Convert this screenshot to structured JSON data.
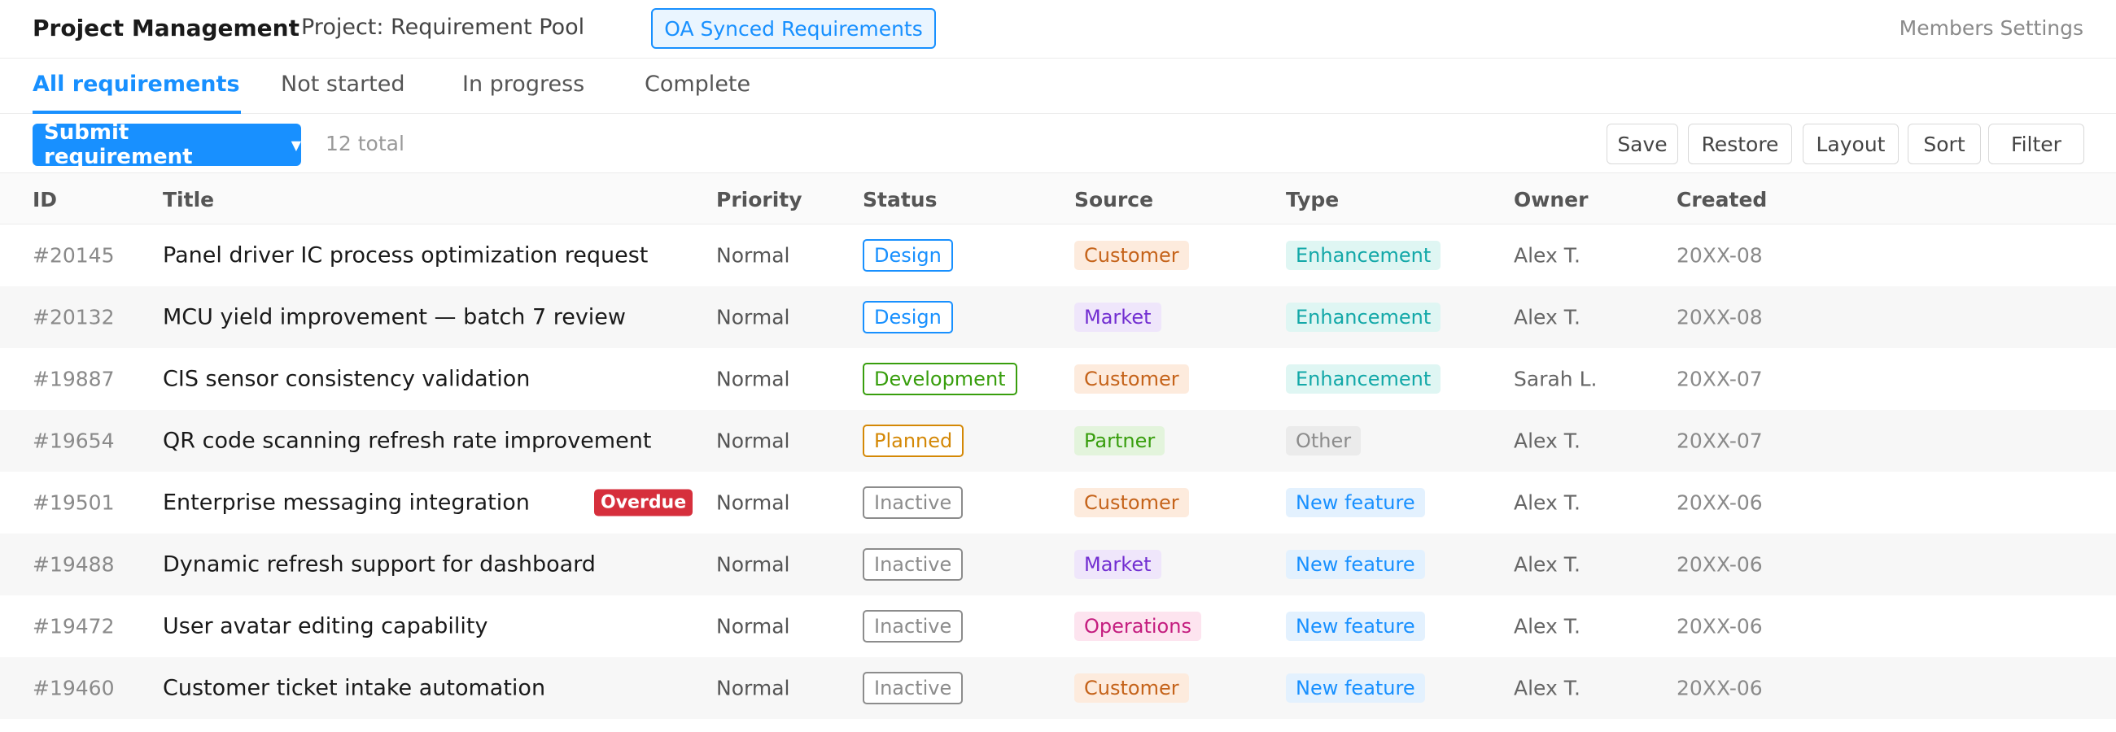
{
  "header": {
    "app_title": "Project Management",
    "project_name": "Project: Requirement Pool",
    "oa_button": "OA Synced Requirements",
    "members_settings": "Members Settings"
  },
  "tabs": [
    {
      "label": "All requirements",
      "active": true
    },
    {
      "label": "Not started",
      "active": false
    },
    {
      "label": "In progress",
      "active": false
    },
    {
      "label": "Complete",
      "active": false
    }
  ],
  "toolbar": {
    "submit_label": "Submit requirement",
    "total": "12 total",
    "buttons": [
      "Save",
      "Restore",
      "Layout",
      "Sort",
      "Filter"
    ]
  },
  "table": {
    "columns": [
      "ID",
      "Title",
      "Priority",
      "Status",
      "Source",
      "Type",
      "Owner",
      "Created"
    ],
    "rows": [
      {
        "id": "#20145",
        "title": "Panel driver IC process optimization request",
        "overdue": "",
        "priority": "Normal",
        "status": "Design",
        "source": "Customer",
        "type": "Enhancement",
        "owner": "Alex T.",
        "created": "20XX-08"
      },
      {
        "id": "#20132",
        "title": "MCU yield improvement — batch 7 review",
        "overdue": "",
        "priority": "Normal",
        "status": "Design",
        "source": "Market",
        "type": "Enhancement",
        "owner": "Alex T.",
        "created": "20XX-08"
      },
      {
        "id": "#19887",
        "title": "CIS sensor consistency validation",
        "overdue": "",
        "priority": "Normal",
        "status": "Development",
        "source": "Customer",
        "type": "Enhancement",
        "owner": "Sarah L.",
        "created": "20XX-07"
      },
      {
        "id": "#19654",
        "title": "QR code scanning refresh rate improvement",
        "overdue": "",
        "priority": "Normal",
        "status": "Planned",
        "source": "Partner",
        "type": "Other",
        "owner": "Alex T.",
        "created": "20XX-07"
      },
      {
        "id": "#19501",
        "title": "Enterprise messaging integration",
        "overdue": "Overdue",
        "priority": "Normal",
        "status": "Inactive",
        "source": "Customer",
        "type": "New feature",
        "owner": "Alex T.",
        "created": "20XX-06"
      },
      {
        "id": "#19488",
        "title": "Dynamic refresh support for dashboard",
        "overdue": "",
        "priority": "Normal",
        "status": "Inactive",
        "source": "Market",
        "type": "New feature",
        "owner": "Alex T.",
        "created": "20XX-06"
      },
      {
        "id": "#19472",
        "title": "User avatar editing capability",
        "overdue": "",
        "priority": "Normal",
        "status": "Inactive",
        "source": "Operations",
        "type": "New feature",
        "owner": "Alex T.",
        "created": "20XX-06"
      },
      {
        "id": "#19460",
        "title": "Customer ticket intake automation",
        "overdue": "",
        "priority": "Normal",
        "status": "Inactive",
        "source": "Customer",
        "type": "New feature",
        "owner": "Alex T.",
        "created": "20XX-06"
      }
    ]
  },
  "colors": {
    "accent": "#1890ff",
    "overdue": "#d62f3c",
    "status": {
      "Design": "#1890ff",
      "Development": "#389e0d",
      "Planned": "#d48806",
      "Inactive": "#8c8c8c"
    },
    "source": {
      "Customer": {
        "bg": "#fdebdd",
        "fg": "#c5631a"
      },
      "Market": {
        "bg": "#efe6fb",
        "fg": "#722ed1"
      },
      "Partner": {
        "bg": "#e3f4dc",
        "fg": "#389e0d"
      },
      "Operations": {
        "bg": "#fde4ef",
        "fg": "#c41d7f"
      }
    },
    "type": {
      "Enhancement": {
        "bg": "#dff6f3",
        "fg": "#13a8a8"
      },
      "Other": {
        "bg": "#ebebeb",
        "fg": "#8c8c8c"
      },
      "New feature": {
        "bg": "#e3f1fe",
        "fg": "#1890ff"
      }
    }
  }
}
